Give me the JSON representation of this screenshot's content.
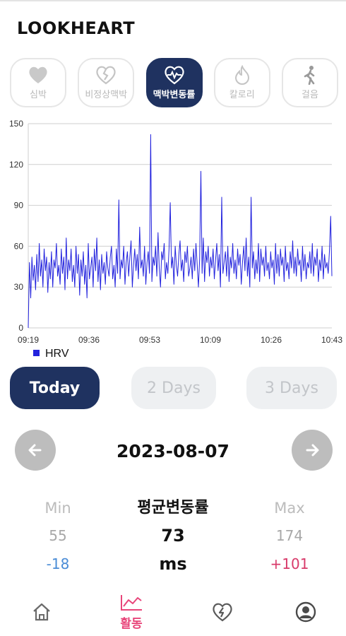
{
  "app": {
    "title": "LOOKHEART"
  },
  "tabs": [
    {
      "label": "심박",
      "icon": "heart-icon",
      "active": false
    },
    {
      "label": "비정상맥박",
      "icon": "broken-heart-icon",
      "active": false
    },
    {
      "label": "맥박변동률",
      "icon": "heart-pulse-icon",
      "active": true
    },
    {
      "label": "칼로리",
      "icon": "flame-icon",
      "active": false
    },
    {
      "label": "걸음",
      "icon": "walking-icon",
      "active": false
    }
  ],
  "chart_data": {
    "type": "line",
    "title": "",
    "xlabel": "",
    "ylabel": "",
    "ylim": [
      0,
      150
    ],
    "y_ticks": [
      "0",
      "30",
      "60",
      "90",
      "120",
      "150"
    ],
    "x_ticks": [
      "09:19",
      "09:36",
      "09:53",
      "10:09",
      "10:26",
      "10:43"
    ],
    "grid": true,
    "legend_position": "bottom-left",
    "series": [
      {
        "name": "HRV",
        "color": "#2222dd",
        "values": [
          0,
          48,
          22,
          52,
          35,
          46,
          28,
          54,
          34,
          62,
          38,
          50,
          30,
          58,
          42,
          52,
          26,
          48,
          36,
          56,
          30,
          50,
          44,
          62,
          38,
          46,
          32,
          58,
          40,
          52,
          28,
          66,
          36,
          50,
          42,
          58,
          34,
          46,
          30,
          60,
          40,
          54,
          24,
          50,
          38,
          56,
          32,
          46,
          22,
          62,
          36,
          44,
          52,
          30,
          58,
          42,
          66,
          34,
          50,
          28,
          54,
          40,
          48,
          32,
          56,
          44,
          38,
          52,
          60,
          36,
          46,
          30,
          58,
          40,
          94,
          36,
          50,
          44,
          60,
          32,
          48,
          56,
          38,
          52,
          64,
          30,
          46,
          58,
          42,
          54,
          36,
          74,
          44,
          50,
          38,
          60,
          32,
          48,
          56,
          40,
          142,
          34,
          52,
          46,
          60,
          38,
          70,
          44,
          30,
          56,
          50,
          62,
          36,
          48,
          40,
          58,
          92,
          44,
          52,
          32,
          60,
          46,
          38,
          54,
          64,
          42,
          50,
          34,
          56,
          48,
          60,
          38,
          44,
          52,
          36,
          58,
          42,
          62,
          46,
          30,
          50,
          115,
          40,
          66,
          34,
          56,
          48,
          60,
          38,
          52,
          44,
          58,
          36,
          50,
          62,
          42,
          54,
          30,
          96,
          40,
          48,
          56,
          38,
          60,
          34,
          52,
          44,
          62,
          40,
          50,
          36,
          58,
          46,
          54,
          32,
          48,
          60,
          42,
          66,
          38,
          52,
          30,
          96,
          44,
          56,
          36,
          50,
          40,
          62,
          34,
          58,
          46,
          52,
          38,
          60,
          42,
          48,
          36,
          56,
          44,
          50,
          32,
          62,
          40,
          54,
          38,
          58,
          46,
          52,
          34,
          60,
          42,
          48,
          36,
          56,
          44,
          64,
          40,
          52,
          38,
          58,
          46,
          50,
          34,
          60,
          42,
          54,
          36,
          48,
          44,
          56,
          40,
          62,
          38,
          52,
          46,
          58,
          34,
          50,
          42,
          60,
          36,
          54,
          44,
          48,
          40,
          56,
          82,
          38
        ]
      }
    ]
  },
  "range": {
    "today": "Today",
    "two_days": "2 Days",
    "three_days": "3 Days"
  },
  "date": {
    "value": "2023-08-07"
  },
  "stats": {
    "min": {
      "label": "Min",
      "value": "55",
      "diff": "-18"
    },
    "avg": {
      "label": "평균변동률",
      "value": "73",
      "unit": "ms"
    },
    "max": {
      "label": "Max",
      "value": "174",
      "diff": "+101"
    }
  },
  "bottom_nav": [
    {
      "label": "",
      "icon": "home-icon"
    },
    {
      "label": "활동",
      "icon": "chart-icon",
      "active": true
    },
    {
      "label": "",
      "icon": "heart-bolt-icon"
    },
    {
      "label": "",
      "icon": "profile-icon"
    }
  ],
  "colors": {
    "primary": "#1f3260",
    "accent": "#e8457a",
    "series": "#2222dd",
    "muted": "#bdbdbd"
  }
}
